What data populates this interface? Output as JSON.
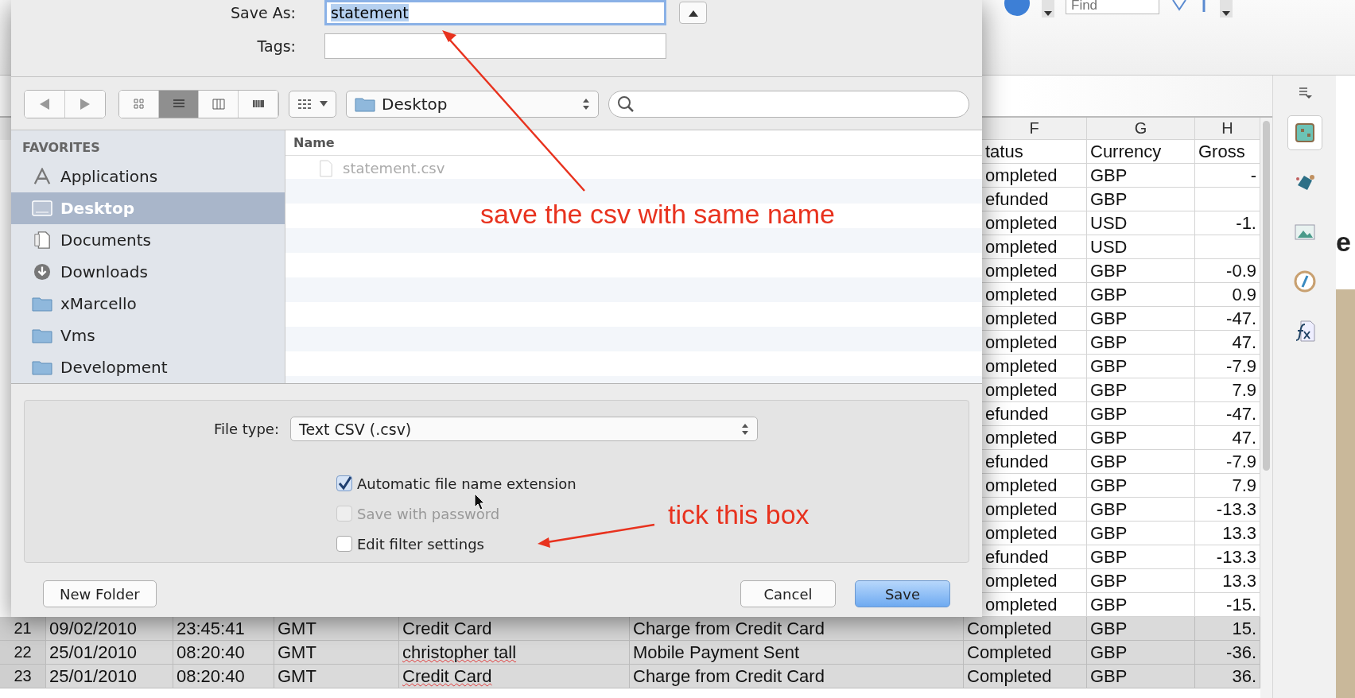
{
  "toolbar": {
    "find_field": {
      "placeholder": "Find"
    }
  },
  "spreadsheet": {
    "column_headers": [
      "F",
      "G",
      "H"
    ],
    "visible_rows": [
      {
        "status": "tatus",
        "currency": "Currency",
        "gross": "Gross"
      },
      {
        "status": "ompleted",
        "currency": "GBP",
        "gross": "-"
      },
      {
        "status": "efunded",
        "currency": "GBP"
      },
      {
        "status": "ompleted",
        "currency": "USD",
        "gross": "-1."
      },
      {
        "status": "ompleted",
        "currency": "USD"
      },
      {
        "status": "ompleted",
        "currency": "GBP",
        "gross": "-0.9"
      },
      {
        "status": "ompleted",
        "currency": "GBP",
        "gross": "0.9"
      },
      {
        "status": "ompleted",
        "currency": "GBP",
        "gross": "-47."
      },
      {
        "status": "ompleted",
        "currency": "GBP",
        "gross": "47."
      },
      {
        "status": "ompleted",
        "currency": "GBP",
        "gross": "-7.9"
      },
      {
        "status": "ompleted",
        "currency": "GBP",
        "gross": "7.9"
      },
      {
        "status": "efunded",
        "currency": "GBP",
        "gross": "-47."
      },
      {
        "status": "ompleted",
        "currency": "GBP",
        "gross": "47."
      },
      {
        "status": "efunded",
        "currency": "GBP",
        "gross": "-7.9"
      },
      {
        "status": "ompleted",
        "currency": "GBP",
        "gross": "7.9"
      },
      {
        "status": "ompleted",
        "currency": "GBP",
        "gross": "-13.3"
      },
      {
        "status": "ompleted",
        "currency": "GBP",
        "gross": "13.3"
      },
      {
        "status": "efunded",
        "currency": "GBP",
        "gross": "-13.3"
      },
      {
        "status": "ompleted",
        "currency": "GBP",
        "gross": "13.3"
      },
      {
        "status": "ompleted",
        "currency": "GBP",
        "gross": "-15."
      }
    ],
    "rows": [
      {
        "number": "21",
        "date": "09/02/2010",
        "time": "23:45:41",
        "timezone": "GMT",
        "name": "Credit Card",
        "misspelled": false,
        "type": "Charge from Credit Card",
        "status": "Completed",
        "currency": "GBP",
        "gross": "15."
      },
      {
        "number": "22",
        "date": "25/01/2010",
        "time": "08:20:40",
        "timezone": "GMT",
        "name": "christopher tall",
        "misspelled": true,
        "type": "Mobile Payment Sent",
        "status": "Completed",
        "currency": "GBP",
        "gross": "-36."
      },
      {
        "number": "23",
        "date": "25/01/2010",
        "time": "08:20:40",
        "timezone": "GMT",
        "name": "Credit Card",
        "misspelled": true,
        "type": "Charge from Credit Card",
        "status": "Completed",
        "currency": "GBP",
        "gross": "36."
      }
    ]
  },
  "side_panel": {
    "tabs": [
      {
        "selected": true
      },
      {
        "selected": false
      },
      {
        "selected": false
      },
      {
        "selected": false
      },
      {
        "selected": false
      }
    ]
  },
  "background_window": {
    "text": "e"
  },
  "dialog": {
    "save_as": {
      "label": "Save As:",
      "value": "statement",
      "text_selected": true
    },
    "tags": {
      "label": "Tags:"
    },
    "view_modes": [
      {
        "selected": false
      },
      {
        "selected": true
      },
      {
        "selected": false
      },
      {
        "selected": false
      }
    ],
    "location": "Desktop",
    "sidebar": {
      "heading": "FAVORITES",
      "items": [
        {
          "label": "Applications",
          "selected": false
        },
        {
          "label": "Desktop",
          "selected": true
        },
        {
          "label": "Documents",
          "selected": false
        },
        {
          "label": "Downloads",
          "selected": false
        },
        {
          "label": "xMarcello",
          "selected": false
        },
        {
          "label": "Vms",
          "selected": false
        },
        {
          "label": "Development",
          "selected": false
        }
      ]
    },
    "file_list": {
      "column": "Name",
      "files": [
        {
          "name": "statement.csv",
          "disabled": true
        }
      ]
    },
    "file_type": {
      "label": "File type:",
      "value": "Text CSV (.csv)"
    },
    "options": [
      {
        "label": "Automatic file name extension",
        "checked": true,
        "disabled": false
      },
      {
        "label": "Save with password",
        "checked": false,
        "disabled": true
      },
      {
        "label": "Edit filter settings",
        "checked": false,
        "disabled": false
      }
    ],
    "buttons": [
      {
        "label": "New Folder",
        "kind": "normal"
      },
      {
        "label": "Cancel",
        "kind": "normal"
      },
      {
        "label": "Save",
        "kind": "default"
      }
    ]
  },
  "annotations": [
    {
      "text": "save the csv with same name"
    },
    {
      "text": "tick this box"
    }
  ]
}
